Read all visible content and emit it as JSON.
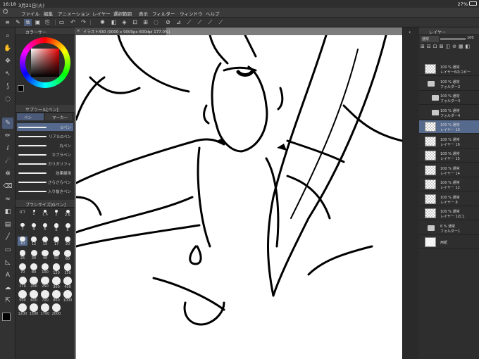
{
  "status": {
    "time": "16:18",
    "date": "3月21日(火)",
    "battery": "27%"
  },
  "menu": [
    "ファイル",
    "編集",
    "アニメーション",
    "レイヤー",
    "選択範囲",
    "表示",
    "フィルター",
    "ウィンドウ",
    "ヘルプ"
  ],
  "colors": {
    "accent": "#566a8e",
    "panel_bg": "#2e2e2e",
    "canvas_bg": "#ffffff",
    "fg_color": "#000000",
    "bg_color": "#ffffff"
  },
  "color_panel": {
    "title": "カラーサー"
  },
  "subtool_panel": {
    "title": "サブツール[ペン]",
    "tabs": [
      "ペン",
      "マーカー"
    ],
    "brushes": [
      "Gペン",
      "リアルGペン",
      "丸ペン",
      "カブラペン",
      "ガリガリフィ",
      "効果線用",
      "さらさらペン",
      "入り抜きペン"
    ],
    "selected_index": 0
  },
  "brush_size_panel": {
    "title": "ブラシサイズ[Gペン]",
    "sizes": [
      "0.7",
      "1",
      "1.5",
      "2",
      "2.5",
      "3",
      "4",
      "5",
      "6",
      "8",
      "10",
      "12",
      "15",
      "17",
      "20",
      "25",
      "30",
      "40",
      "50",
      "60",
      "70",
      "80",
      "100",
      "120",
      "150",
      "170",
      "200",
      "250",
      "300",
      "400",
      "500",
      "600",
      "700",
      "800",
      "1000",
      "1200",
      "1500",
      "1700",
      "2000"
    ],
    "selected": "10"
  },
  "canvas": {
    "tab_label": "イラスト430 (9000 x 9000px 600dpi 177.0%)"
  },
  "layer_panel": {
    "title": "レイヤー",
    "blend_mode": "通常",
    "opacity": "100",
    "layers": [
      {
        "name": "レイヤー6のコピー",
        "mode": "100 % 通常",
        "kind": "layer",
        "indent": 0,
        "selected": false
      },
      {
        "name": "フォルダー2",
        "mode": "100 % 通常",
        "kind": "folder",
        "indent": 0,
        "selected": false
      },
      {
        "name": "フォルダー3",
        "mode": "100 % 通常",
        "kind": "folder",
        "indent": 1,
        "selected": false
      },
      {
        "name": "フォルダー4",
        "mode": "100 % 通常",
        "kind": "folder",
        "indent": 1,
        "selected": false
      },
      {
        "name": "レイヤー 19",
        "mode": "100 % 通常",
        "kind": "layer",
        "indent": 0,
        "selected": true
      },
      {
        "name": "レイヤー 16",
        "mode": "100 % 通常",
        "kind": "layer",
        "indent": 0,
        "selected": false
      },
      {
        "name": "レイヤー 15",
        "mode": "100 % 通常",
        "kind": "layer",
        "indent": 0,
        "selected": false
      },
      {
        "name": "レイヤー 14",
        "mode": "100 % 通常",
        "kind": "layer",
        "indent": 0,
        "selected": false
      },
      {
        "name": "レイヤー 12",
        "mode": "100 % 通常",
        "kind": "layer",
        "indent": 0,
        "selected": false
      },
      {
        "name": "レイヤー 8",
        "mode": "100 % 通常",
        "kind": "layer",
        "indent": 0,
        "selected": false
      },
      {
        "name": "レイヤー 1のコ",
        "mode": "100 % 通常",
        "kind": "layer",
        "indent": 0,
        "selected": false
      },
      {
        "name": "フォルダー1",
        "mode": "6 % 通常",
        "kind": "folder",
        "indent": 0,
        "selected": false
      },
      {
        "name": "用紙",
        "mode": "",
        "kind": "paper",
        "indent": 0,
        "selected": false
      }
    ]
  }
}
